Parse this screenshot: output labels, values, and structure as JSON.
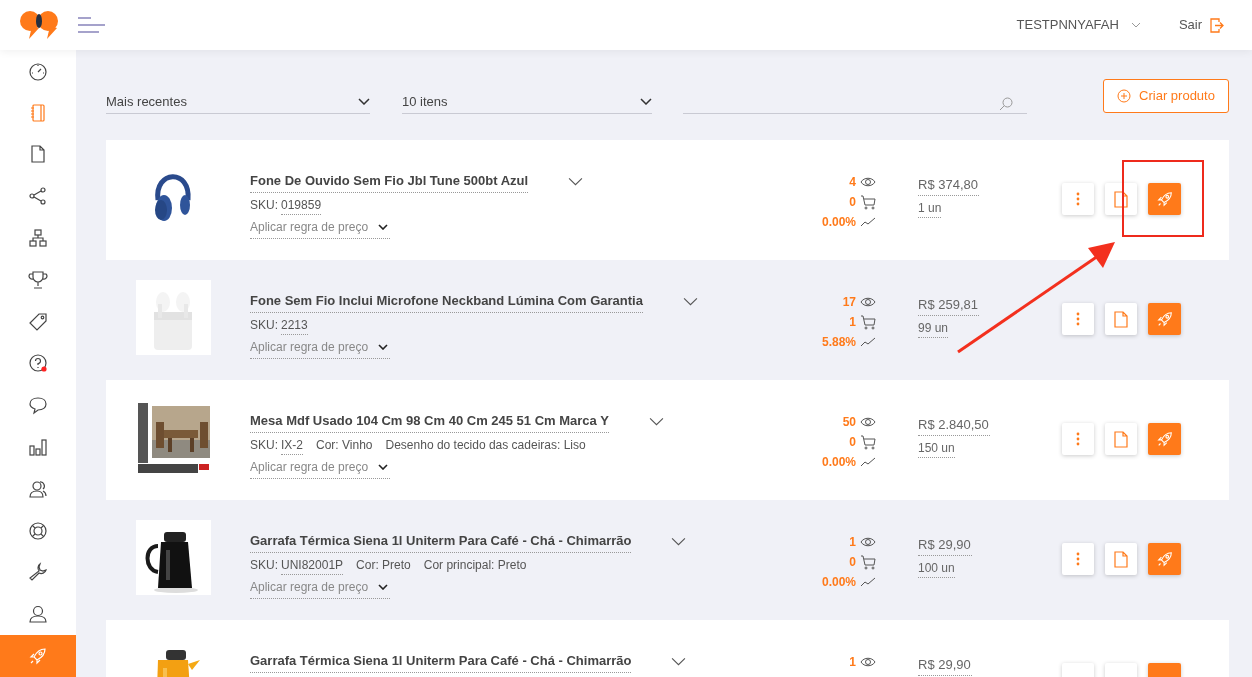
{
  "header": {
    "user": "TESTPNNYAFAH",
    "logout": "Sair"
  },
  "sidebar": {
    "items": [
      {
        "kind": "gauge",
        "current": false,
        "selected": false,
        "badge": false
      },
      {
        "kind": "notebook",
        "current": true,
        "selected": false,
        "badge": false
      },
      {
        "kind": "document",
        "current": false,
        "selected": false,
        "badge": false
      },
      {
        "kind": "share",
        "current": false,
        "selected": false,
        "badge": false
      },
      {
        "kind": "sitemap",
        "current": false,
        "selected": false,
        "badge": false
      },
      {
        "kind": "trophy",
        "current": false,
        "selected": false,
        "badge": false
      },
      {
        "kind": "tag",
        "current": false,
        "selected": false,
        "badge": false
      },
      {
        "kind": "help",
        "current": false,
        "selected": false,
        "badge": true
      },
      {
        "kind": "chat",
        "current": false,
        "selected": false,
        "badge": false
      },
      {
        "kind": "chart",
        "current": false,
        "selected": false,
        "badge": false
      },
      {
        "kind": "users",
        "current": false,
        "selected": false,
        "badge": false
      },
      {
        "kind": "lifebuoy",
        "current": false,
        "selected": false,
        "badge": false
      },
      {
        "kind": "wrench",
        "current": false,
        "selected": false,
        "badge": false
      },
      {
        "kind": "user",
        "current": false,
        "selected": false,
        "badge": false
      },
      {
        "kind": "rocket",
        "current": false,
        "selected": true,
        "badge": false
      }
    ]
  },
  "filters": {
    "sort": "Mais recentes",
    "page_size": "10 itens",
    "create_button": "Criar produto"
  },
  "products": [
    {
      "title": "Fone De Ouvido Sem Fio Jbl Tune 500bt Azul",
      "sku_label": "SKU:",
      "sku": "019859",
      "price_rule": "Aplicar regra de preço",
      "views": "4",
      "cart": "0",
      "conversion": "0.00%",
      "price": "R$ 374,80",
      "quantity": "1 un"
    },
    {
      "title": "Fone Sem Fio Inclui Microfone Neckband Lúmina Com Garantia",
      "sku_label": "SKU:",
      "sku": "2213",
      "price_rule": "Aplicar regra de preço",
      "views": "17",
      "cart": "1",
      "conversion": "5.88%",
      "price": "R$ 259,81",
      "quantity": "99 un"
    },
    {
      "title": "Mesa Mdf Usado 104 Cm 98 Cm 40 Cm 245 51 Cm Marca Y",
      "sku_label": "SKU:",
      "sku": "IX-2",
      "attributes": [
        "Cor: Vinho",
        "Desenho do tecido das cadeiras: Liso"
      ],
      "price_rule": "Aplicar regra de preço",
      "views": "50",
      "cart": "0",
      "conversion": "0.00%",
      "price": "R$ 2.840,50",
      "quantity": "150 un"
    },
    {
      "title": "Garrafa Térmica Siena 1l Uniterm Para Café - Chá - Chimarrão",
      "sku_label": "SKU:",
      "sku": "UNI82001P",
      "attributes": [
        "Cor: Preto",
        "Cor principal: Preto"
      ],
      "price_rule": "Aplicar regra de preço",
      "views": "1",
      "cart": "0",
      "conversion": "0.00%",
      "price": "R$ 29,90",
      "quantity": "100 un"
    },
    {
      "title": "Garrafa Térmica Siena 1l Uniterm Para Café - Chá - Chimarrão",
      "views": "1",
      "price": "R$ 29,90"
    }
  ]
}
